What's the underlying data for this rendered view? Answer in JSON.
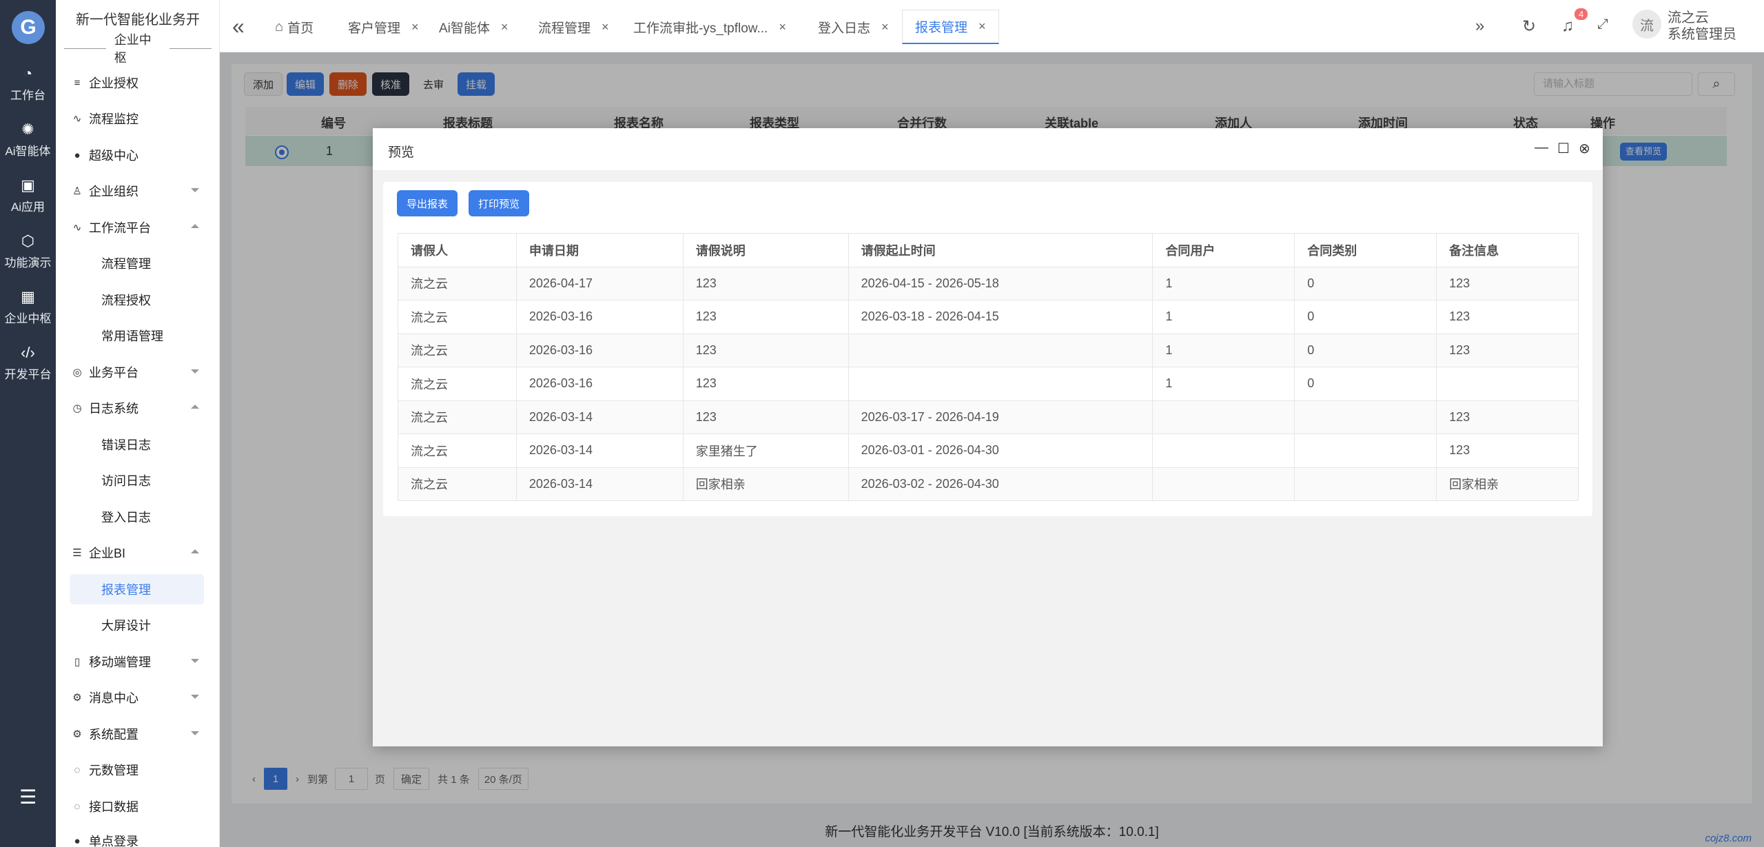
{
  "rail": {
    "logo": "G",
    "items": [
      {
        "icon": "dashboard-icon",
        "label": "工作台"
      },
      {
        "icon": "ai-icon",
        "label": "Ai智能体"
      },
      {
        "icon": "app-icon",
        "label": "Ai应用"
      },
      {
        "icon": "cube-icon",
        "label": "功能演示"
      },
      {
        "icon": "grid-icon",
        "label": "企业中枢"
      },
      {
        "icon": "code-icon",
        "label": "开发平台"
      }
    ]
  },
  "menu": {
    "brand": "新一代智能化业务开",
    "sub_brand": "企业中枢",
    "items": [
      {
        "label": "企业授权",
        "icon": "sliders-icon"
      },
      {
        "label": "流程监控",
        "icon": "pulse-icon"
      },
      {
        "label": "超级中心",
        "icon": "drop-icon"
      },
      {
        "label": "企业组织",
        "icon": "user-icon"
      },
      {
        "label": "工作流平台",
        "icon": "pulse-icon"
      },
      {
        "label": "流程管理"
      },
      {
        "label": "流程授权"
      },
      {
        "label": "常用语管理"
      },
      {
        "label": "业务平台",
        "icon": "target-icon"
      },
      {
        "label": "日志系统",
        "icon": "clock-icon"
      },
      {
        "label": "错误日志"
      },
      {
        "label": "访问日志"
      },
      {
        "label": "登入日志"
      },
      {
        "label": "企业BI",
        "icon": "list-icon"
      },
      {
        "label": "报表管理"
      },
      {
        "label": "大屏设计"
      },
      {
        "label": "移动端管理",
        "icon": "mobile-icon"
      },
      {
        "label": "消息中心",
        "icon": "gear-icon"
      },
      {
        "label": "系统配置",
        "icon": "gear-icon"
      },
      {
        "label": "元数管理",
        "icon": "spinner-icon"
      },
      {
        "label": "接口数据",
        "icon": "spinner-icon"
      },
      {
        "label": "单点登录",
        "icon": "drop-icon"
      }
    ]
  },
  "tabs": [
    {
      "label": "首页"
    },
    {
      "label": "客户管理"
    },
    {
      "label": "Ai智能体"
    },
    {
      "label": "流程管理"
    },
    {
      "label": "工作流审批-ys_tpflow..."
    },
    {
      "label": "登入日志"
    },
    {
      "label": "报表管理"
    }
  ],
  "header": {
    "badge": "4",
    "avatar": "流",
    "user_name": "流之云",
    "user_role": "系统管理员"
  },
  "toolbar": {
    "buttons": [
      "添加",
      "编辑",
      "删除",
      "核准",
      "去审",
      "挂载"
    ],
    "colors": [
      "#f5f5f5",
      "#3b7de9",
      "#e0531e",
      "#2b3444",
      "#ffffff",
      "#3b7de9"
    ],
    "search_placeholder": "请输入标题"
  },
  "bg_table": {
    "columns": [
      "编号",
      "报表标题",
      "报表名称",
      "报表类型",
      "合并行数",
      "关联table",
      "添加人",
      "添加时间",
      "状态",
      "操作"
    ],
    "row": {
      "num": "1",
      "action": "查看预览"
    }
  },
  "pager": {
    "current": "1",
    "goto": "到第",
    "page_input": "1",
    "page_unit": "页",
    "confirm": "确定",
    "total": "共 1 条",
    "size": "20 条/页"
  },
  "footer": "新一代智能化业务开发平台 V10.0 [当前系统版本：10.0.1]",
  "corner": "cojz8.com",
  "modal": {
    "title": "预览",
    "export_btn": "导出报表",
    "print_btn": "打印预览",
    "columns": [
      "请假人",
      "申请日期",
      "请假说明",
      "请假起止时间",
      "合同用户",
      "合同类别",
      "备注信息"
    ],
    "rows": [
      [
        "流之云",
        "2026-04-17",
        "123",
        "2026-04-15 - 2026-05-18",
        "1",
        "0",
        "123"
      ],
      [
        "流之云",
        "2026-03-16",
        "123",
        "2026-03-18 - 2026-04-15",
        "1",
        "0",
        "123"
      ],
      [
        "流之云",
        "2026-03-16",
        "123",
        "",
        "1",
        "0",
        "123"
      ],
      [
        "流之云",
        "2026-03-16",
        "123",
        "",
        "1",
        "0",
        ""
      ],
      [
        "流之云",
        "2026-03-14",
        "123",
        "2026-03-17 - 2026-04-19",
        "",
        "",
        "123"
      ],
      [
        "流之云",
        "2026-03-14",
        "家里猪生了",
        "2026-03-01 - 2026-04-30",
        "",
        "",
        "123"
      ],
      [
        "流之云",
        "2026-03-14",
        "回家相亲",
        "2026-03-02 - 2026-04-30",
        "",
        "",
        "回家相亲"
      ]
    ]
  }
}
